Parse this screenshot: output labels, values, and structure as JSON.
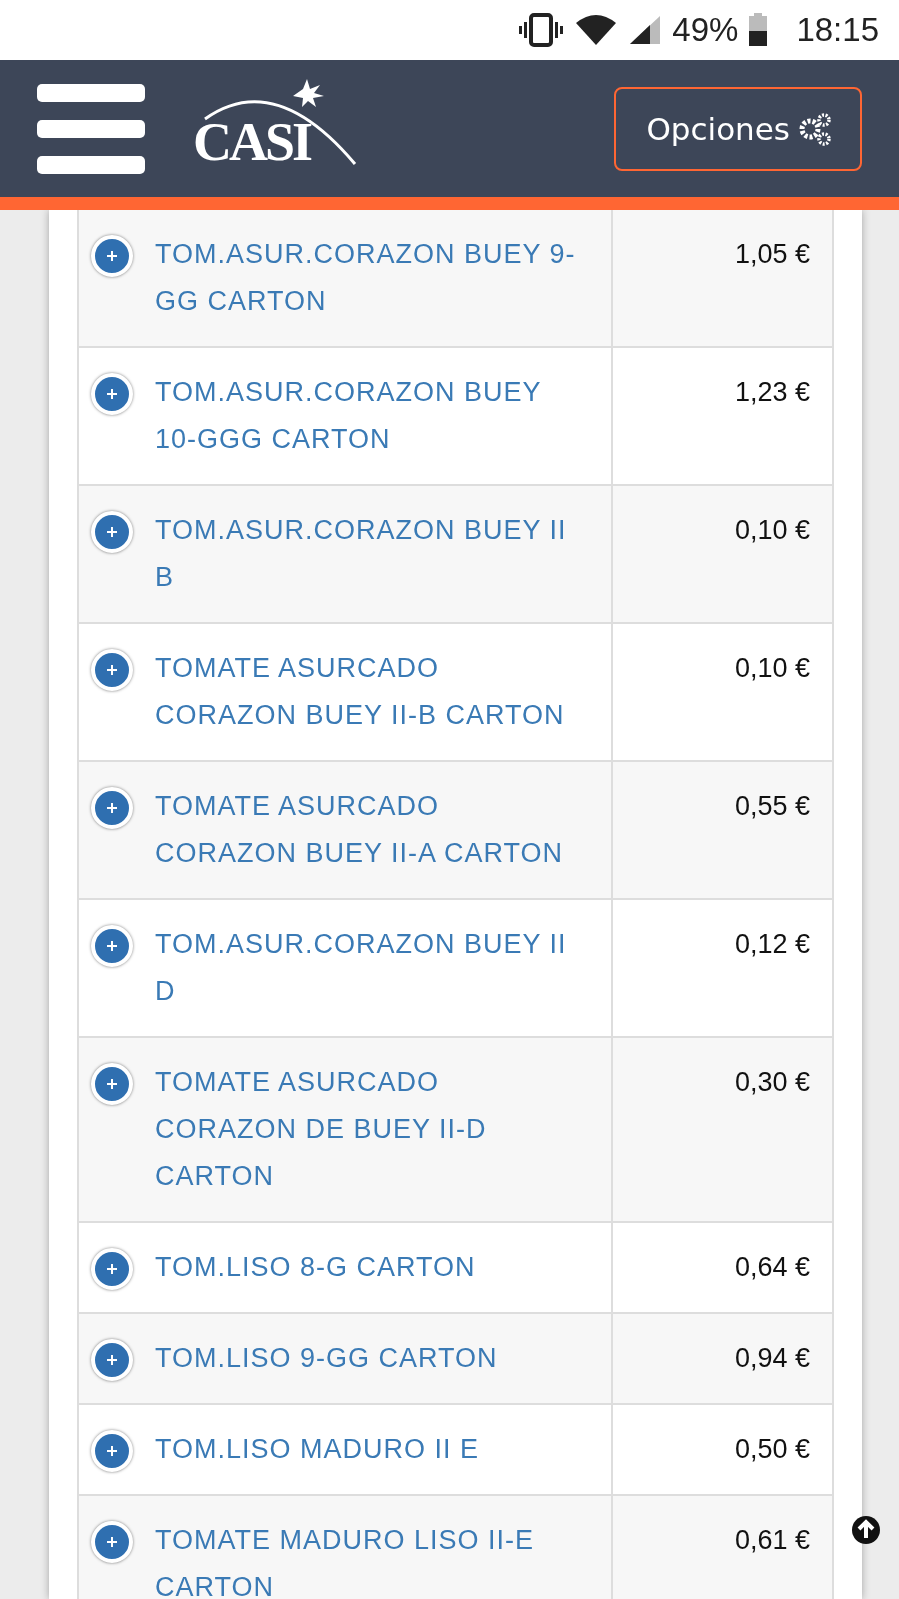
{
  "status_bar": {
    "battery": "49%",
    "time": "18:15"
  },
  "header": {
    "logo": "CASI",
    "options_button": "Opciones"
  },
  "products": [
    {
      "name": "TOM.ASUR.CORAZON BUEY 9-GG CARTON",
      "price": "1,05 €"
    },
    {
      "name": "TOM.ASUR.CORAZON BUEY 10-GGG CARTON",
      "price": "1,23 €"
    },
    {
      "name": "TOM.ASUR.CORAZON BUEY II B",
      "price": "0,10 €"
    },
    {
      "name": "TOMATE ASURCADO CORAZON BUEY II-B CARTON",
      "price": "0,10 €"
    },
    {
      "name": "TOMATE ASURCADO CORAZON BUEY II-A CARTON",
      "price": "0,55 €"
    },
    {
      "name": "TOM.ASUR.CORAZON BUEY II D",
      "price": "0,12 €"
    },
    {
      "name": "TOMATE ASURCADO CORAZON DE BUEY II-D CARTON",
      "price": "0,30 €"
    },
    {
      "name": "TOM.LISO 8-G CARTON",
      "price": "0,64 €"
    },
    {
      "name": "TOM.LISO 9-GG CARTON",
      "price": "0,94 €"
    },
    {
      "name": "TOM.LISO MADURO II E",
      "price": "0,50 €"
    },
    {
      "name": "TOMATE MADURO LISO II-E CARTON",
      "price": "0,61 €"
    }
  ]
}
